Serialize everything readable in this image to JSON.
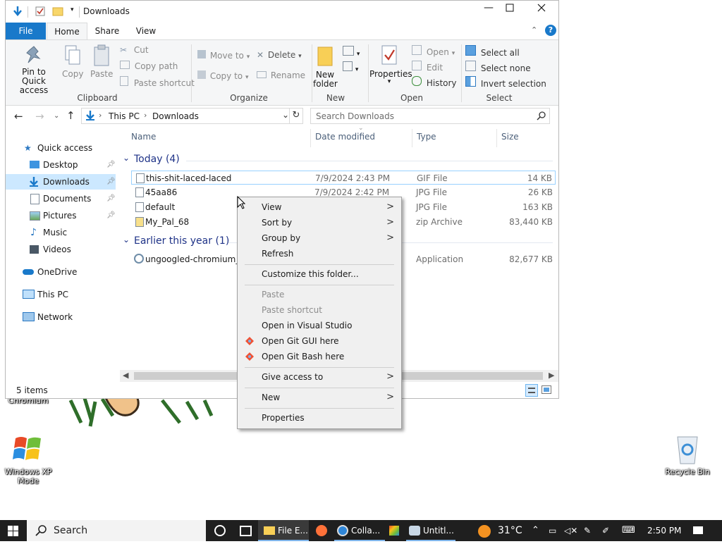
{
  "desktop": {
    "icons": [
      {
        "label": "Chromium"
      },
      {
        "label": "Windows XP Mode"
      },
      {
        "label": "Recycle Bin"
      }
    ]
  },
  "window": {
    "title": "Downloads",
    "ribbon_tabs": [
      "File",
      "Home",
      "Share",
      "View"
    ],
    "ribbon": {
      "clipboard": {
        "pin": "Pin to Quick access",
        "copy": "Copy",
        "paste": "Paste",
        "cut": "Cut",
        "copy_path": "Copy path",
        "paste_shortcut": "Paste shortcut",
        "label": "Clipboard"
      },
      "organize": {
        "move_to": "Move to",
        "copy_to": "Copy to",
        "delete": "Delete",
        "rename": "Rename",
        "label": "Organize"
      },
      "new": {
        "new_folder": "New folder",
        "label": "New"
      },
      "open": {
        "properties": "Properties",
        "open": "Open",
        "edit": "Edit",
        "history": "History",
        "label": "Open"
      },
      "select": {
        "select_all": "Select all",
        "select_none": "Select none",
        "invert": "Invert selection",
        "label": "Select"
      }
    },
    "address": {
      "crumbs": [
        "This PC",
        "Downloads"
      ],
      "search_placeholder": "Search Downloads"
    },
    "nav": [
      {
        "label": "Quick access"
      },
      {
        "label": "Desktop"
      },
      {
        "label": "Downloads"
      },
      {
        "label": "Documents"
      },
      {
        "label": "Pictures"
      },
      {
        "label": "Music"
      },
      {
        "label": "Videos"
      },
      {
        "label": "OneDrive"
      },
      {
        "label": "This PC"
      },
      {
        "label": "Network"
      }
    ],
    "columns": [
      "Name",
      "Date modified",
      "Type",
      "Size"
    ],
    "groups": [
      {
        "title": "Today (4)",
        "files": [
          {
            "name": "this-shit-laced-laced",
            "date": "7/9/2024 2:43 PM",
            "type": "GIF File",
            "size": "14 KB"
          },
          {
            "name": "45aa86",
            "date": "7/9/2024 2:42 PM",
            "type": "JPG File",
            "size": "26 KB"
          },
          {
            "name": "default",
            "date": "",
            "type": "JPG File",
            "size": "163 KB"
          },
          {
            "name": "My_Pal_68",
            "date": "",
            "type": "zip Archive",
            "size": "83,440 KB"
          }
        ]
      },
      {
        "title": "Earlier this year (1)",
        "files": [
          {
            "name": "ungoogled-chromium_1",
            "date": "",
            "type": "Application",
            "size": "82,677 KB"
          }
        ]
      }
    ],
    "status": "5 items"
  },
  "context_menu": {
    "items": [
      "View",
      "Sort by",
      "Group by",
      "Refresh",
      "Customize this folder...",
      "Paste",
      "Paste shortcut",
      "Open in Visual Studio",
      "Open Git GUI here",
      "Open Git Bash here",
      "Give access to",
      "New",
      "Properties"
    ]
  },
  "taskbar": {
    "search": "Search",
    "apps": [
      "File E...",
      "Colla...",
      "Untitl..."
    ],
    "weather": "31°C",
    "time": "2:50 PM"
  },
  "colors": {
    "accent": "#1979ca",
    "selected_bg": "#cce8ff",
    "taskbar": "#1f1f1f"
  }
}
